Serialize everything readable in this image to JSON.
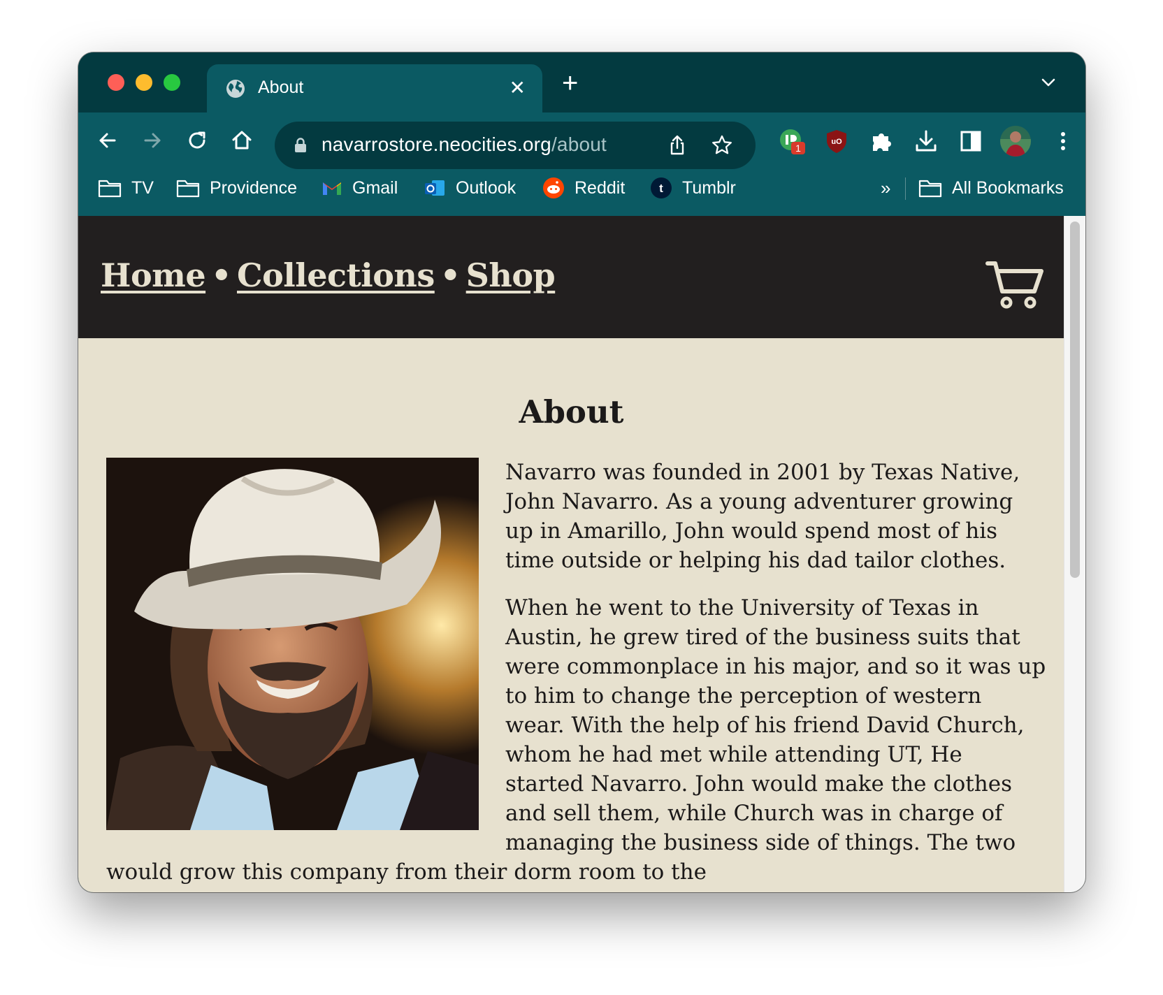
{
  "browser": {
    "tab": {
      "title": "About",
      "favicon": "globe-icon",
      "close": "✕"
    },
    "new_tab": "+",
    "url": {
      "domain": "navarrostore.neocities.org",
      "path": "/about"
    },
    "extensions": [
      {
        "name": "instapaper-extension",
        "badge": "1"
      },
      {
        "name": "ublock-extension"
      },
      {
        "name": "puzzle-extensions-icon"
      },
      {
        "name": "download-icon"
      },
      {
        "name": "side-panel-icon"
      },
      {
        "name": "profile-avatar"
      },
      {
        "name": "kebab-menu-icon"
      }
    ],
    "bookmarks": [
      {
        "label": "TV",
        "icon": "folder-icon"
      },
      {
        "label": "Providence",
        "icon": "folder-icon"
      },
      {
        "label": "Gmail",
        "icon": "gmail-icon"
      },
      {
        "label": "Outlook",
        "icon": "outlook-icon"
      },
      {
        "label": "Reddit",
        "icon": "reddit-icon"
      },
      {
        "label": "Tumblr",
        "icon": "tumblr-icon"
      }
    ],
    "bookmarks_overflow": "»",
    "all_bookmarks": "All Bookmarks",
    "colors": {
      "frame": "#033a40",
      "toolbar": "#0b5a63"
    }
  },
  "site": {
    "nav": {
      "home": "Home",
      "collections": "Collections",
      "shop": "Shop",
      "separator": "•"
    },
    "cart_icon": "cart-icon",
    "colors": {
      "header_bg": "#221f1f",
      "page_bg": "#e7e1cf",
      "text": "#1b1919"
    }
  },
  "page": {
    "title": "About",
    "portrait_alt": "portrait of man in white cowboy hat",
    "paragraphs": [
      "Navarro was founded in 2001 by Texas Native, John Navarro. As a young adventurer growing up in Amarillo, John would spend most of his time outside or helping his dad tailor clothes.",
      "When he went to the University of Texas in Austin, he grew tired of the business suits that were commonplace in his major, and so it was up to him to change the perception of western wear. With the help of his friend David Church, whom he had met while attending UT, He started Navarro. John would make the clothes and sell them, while Church was in charge of managing the business side of things. The two would grow this company from their dorm room to the"
    ]
  }
}
